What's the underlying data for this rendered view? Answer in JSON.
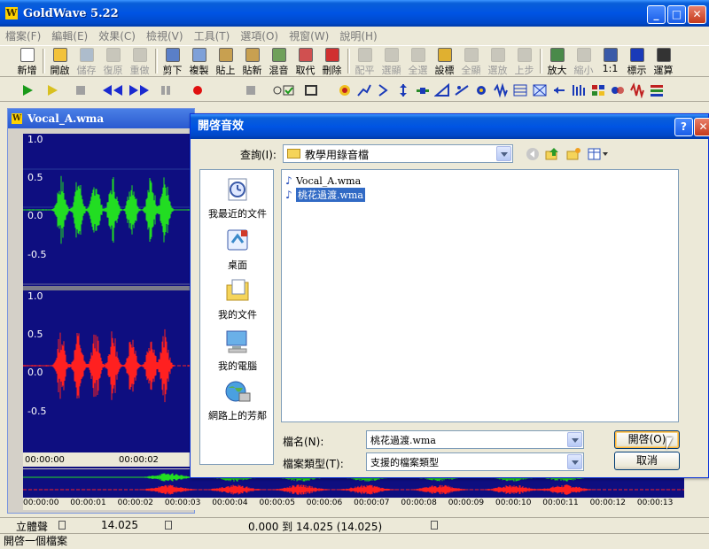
{
  "window": {
    "title": "GoldWave 5.22",
    "logo": "W",
    "controls": {
      "minimize": "_",
      "maximize": "□",
      "close": "✕"
    }
  },
  "menu": [
    "檔案(F)",
    "編輯(E)",
    "效果(C)",
    "檢視(V)",
    "工具(T)",
    "選項(O)",
    "視窗(W)",
    "說明(H)"
  ],
  "toolbar1": [
    {
      "label": "新增",
      "enabled": true,
      "icon": "new-file-icon",
      "color": "#ffffff"
    },
    {
      "label": "開啟",
      "enabled": true,
      "icon": "open-folder-icon",
      "color": "#f2c23a"
    },
    {
      "label": "儲存",
      "enabled": false,
      "icon": "save-icon",
      "color": "#3a6ab8"
    },
    {
      "label": "復原",
      "enabled": false,
      "icon": "undo-icon",
      "color": "#888888"
    },
    {
      "label": "重做",
      "enabled": false,
      "icon": "redo-icon",
      "color": "#888888"
    },
    {
      "label": "剪下",
      "enabled": true,
      "icon": "cut-icon",
      "color": "#5a7fc8"
    },
    {
      "label": "複製",
      "enabled": true,
      "icon": "copy-icon",
      "color": "#7ea0d8"
    },
    {
      "label": "貼上",
      "enabled": true,
      "icon": "paste-icon",
      "color": "#c8a050"
    },
    {
      "label": "貼新",
      "enabled": true,
      "icon": "paste-new-icon",
      "color": "#c8a050"
    },
    {
      "label": "混音",
      "enabled": true,
      "icon": "mix-icon",
      "color": "#6fa05a"
    },
    {
      "label": "取代",
      "enabled": true,
      "icon": "replace-icon",
      "color": "#d05050"
    },
    {
      "label": "刪除",
      "enabled": true,
      "icon": "delete-icon",
      "color": "#d03030"
    },
    {
      "label": "配平",
      "enabled": false,
      "icon": "trim-icon",
      "color": "#888888"
    },
    {
      "label": "選顯",
      "enabled": false,
      "icon": "select-view-icon",
      "color": "#888888"
    },
    {
      "label": "全選",
      "enabled": false,
      "icon": "select-all-icon",
      "color": "#888888"
    },
    {
      "label": "設標",
      "enabled": true,
      "icon": "set-marker-icon",
      "color": "#e0b030"
    },
    {
      "label": "全顯",
      "enabled": false,
      "icon": "show-all-icon",
      "color": "#888888"
    },
    {
      "label": "選放",
      "enabled": false,
      "icon": "zoom-selection-icon",
      "color": "#888888"
    },
    {
      "label": "上步",
      "enabled": false,
      "icon": "previous-icon",
      "color": "#888888"
    },
    {
      "label": "放大",
      "enabled": true,
      "icon": "zoom-in-icon",
      "color": "#4a8a4a"
    },
    {
      "label": "縮小",
      "enabled": false,
      "icon": "zoom-out-icon",
      "color": "#888888"
    },
    {
      "label": "1:1",
      "enabled": true,
      "icon": "zoom-1-1-icon",
      "color": "#3a5aa8"
    },
    {
      "label": "標示",
      "enabled": true,
      "icon": "cue-marker-icon",
      "color": "#1a3ab8"
    },
    {
      "label": "運算",
      "enabled": true,
      "icon": "expression-icon",
      "color": "#333333"
    }
  ],
  "document": {
    "title": "Vocal_A.wma",
    "top_channel_labels": [
      "1.0",
      "0.5",
      "0.0",
      "-0.5"
    ],
    "bottom_channel_labels": [
      "1.0",
      "0.5",
      "0.0",
      "-0.5"
    ],
    "time_labels": [
      "00:00:00",
      "00:00:02"
    ]
  },
  "overview": {
    "time_labels": [
      "00:00:00",
      "00:00:01",
      "00:00:02",
      "00:00:03",
      "00:00:04",
      "00:00:05",
      "00:00:06",
      "00:00:07",
      "00:00:08",
      "00:00:09",
      "00:00:10",
      "00:00:11",
      "00:00:12",
      "00:00:13"
    ]
  },
  "status": {
    "channel": "立體聲",
    "length": "14.025",
    "selection": "0.000 到 14.025 (14.025)",
    "message": "開啓一個檔案"
  },
  "dialog": {
    "title": "開啓音效",
    "help": "?",
    "close": "✕",
    "look_in_label": "查詢(I):",
    "look_in_value": "教學用錄音檔",
    "places": [
      {
        "label": "我最近的文件",
        "icon": "recent-documents-icon"
      },
      {
        "label": "桌面",
        "icon": "desktop-icon"
      },
      {
        "label": "我的文件",
        "icon": "my-documents-icon"
      },
      {
        "label": "我的電腦",
        "icon": "my-computer-icon"
      },
      {
        "label": "網路上的芳鄰",
        "icon": "network-places-icon"
      }
    ],
    "files": [
      {
        "name": "Vocal_A.wma",
        "selected": false
      },
      {
        "name": "桃花過渡.wma",
        "selected": true
      }
    ],
    "filename_label": "檔名(N):",
    "filename_value": "桃花過渡.wma",
    "filetype_label": "檔案類型(T):",
    "filetype_value": "支援的檔案類型",
    "open_button": "開啓(O)",
    "cancel_button": "取消"
  },
  "colors": {
    "title_bar": "#0054e3",
    "wave_background": "#0e0e80",
    "left_channel": "#22dd22",
    "right_channel": "#ff2020"
  }
}
